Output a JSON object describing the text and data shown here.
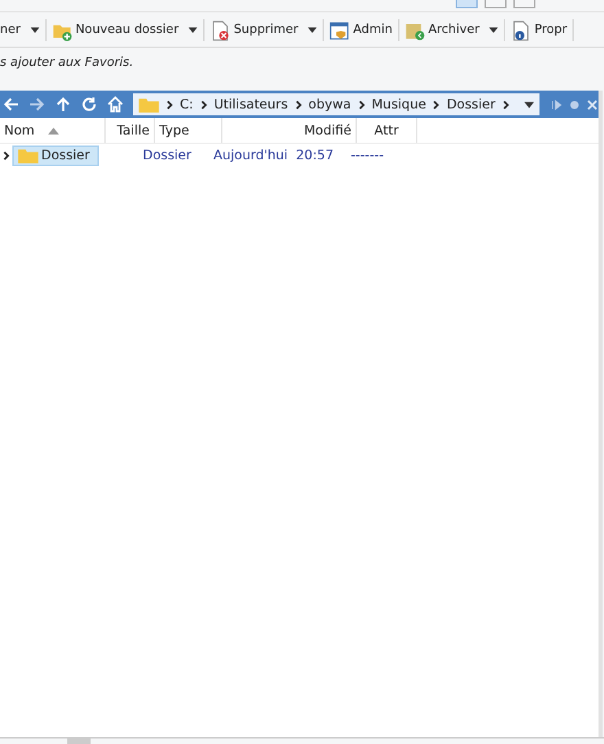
{
  "toolbar": [
    {
      "kind": "cut",
      "label": "ner",
      "dropdown": true
    },
    {
      "kind": "new-folder",
      "label": "Nouveau dossier",
      "dropdown": true
    },
    {
      "kind": "delete",
      "label": "Supprimer",
      "dropdown": true
    },
    {
      "kind": "admin",
      "label": "Admin",
      "dropdown": false
    },
    {
      "kind": "archive",
      "label": "Archiver",
      "dropdown": true
    },
    {
      "kind": "properties",
      "label": "Propr",
      "dropdown": false
    }
  ],
  "hint": "s ajouter aux Favoris.",
  "breadcrumb": [
    "C:",
    "Utilisateurs",
    "obywa",
    "Musique",
    "Dossier"
  ],
  "columns": [
    {
      "label": "Nom",
      "sorted": true
    },
    {
      "label": "Taille",
      "sorted": false
    },
    {
      "label": "Type",
      "sorted": false
    },
    {
      "label": "Modifié",
      "sorted": false
    },
    {
      "label": "Attr",
      "sorted": false
    }
  ],
  "rows": [
    {
      "name": "Dossier",
      "size": "",
      "type": "Dossier",
      "date": "Aujourd'hui",
      "time": "20:57",
      "attr": "-------",
      "selected": true
    }
  ]
}
